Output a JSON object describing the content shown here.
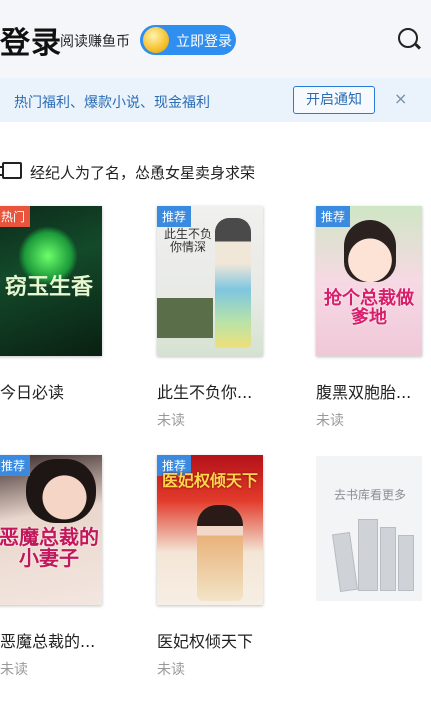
{
  "header": {
    "title": "登录",
    "coin_text": "阅读赚鱼币",
    "login_button": "立即登录"
  },
  "banner": {
    "text": "热门福利、爆款小说、现金福利",
    "notify_button": "开启通知",
    "close": "×"
  },
  "notice": {
    "text": "经纪人为了名，怂恿女星卖身求荣"
  },
  "books": [
    {
      "title": "今日必读",
      "status": "",
      "badge": "热门",
      "cover_text": "窃玉生香"
    },
    {
      "title": "此生不负你...",
      "status": "未读",
      "badge": "推荐",
      "cover_text": "此生不负你情深"
    },
    {
      "title": "腹黑双胞胎...",
      "status": "未读",
      "badge": "推荐",
      "cover_text": "抢个总裁做爹地"
    },
    {
      "title": "恶魔总裁的...",
      "status": "未读",
      "badge": "推荐",
      "cover_text": "恶魔总裁的小妻子"
    },
    {
      "title": "医妃权倾天下",
      "status": "未读",
      "badge": "推荐",
      "cover_text": "医妃权倾天下"
    }
  ],
  "library": {
    "text": "去书库看更多"
  },
  "colors": {
    "accent": "#2e8ff0",
    "banner_text": "#2a6db5",
    "hot_badge": "#e8553c",
    "rec_badge": "#3a8ae0"
  }
}
